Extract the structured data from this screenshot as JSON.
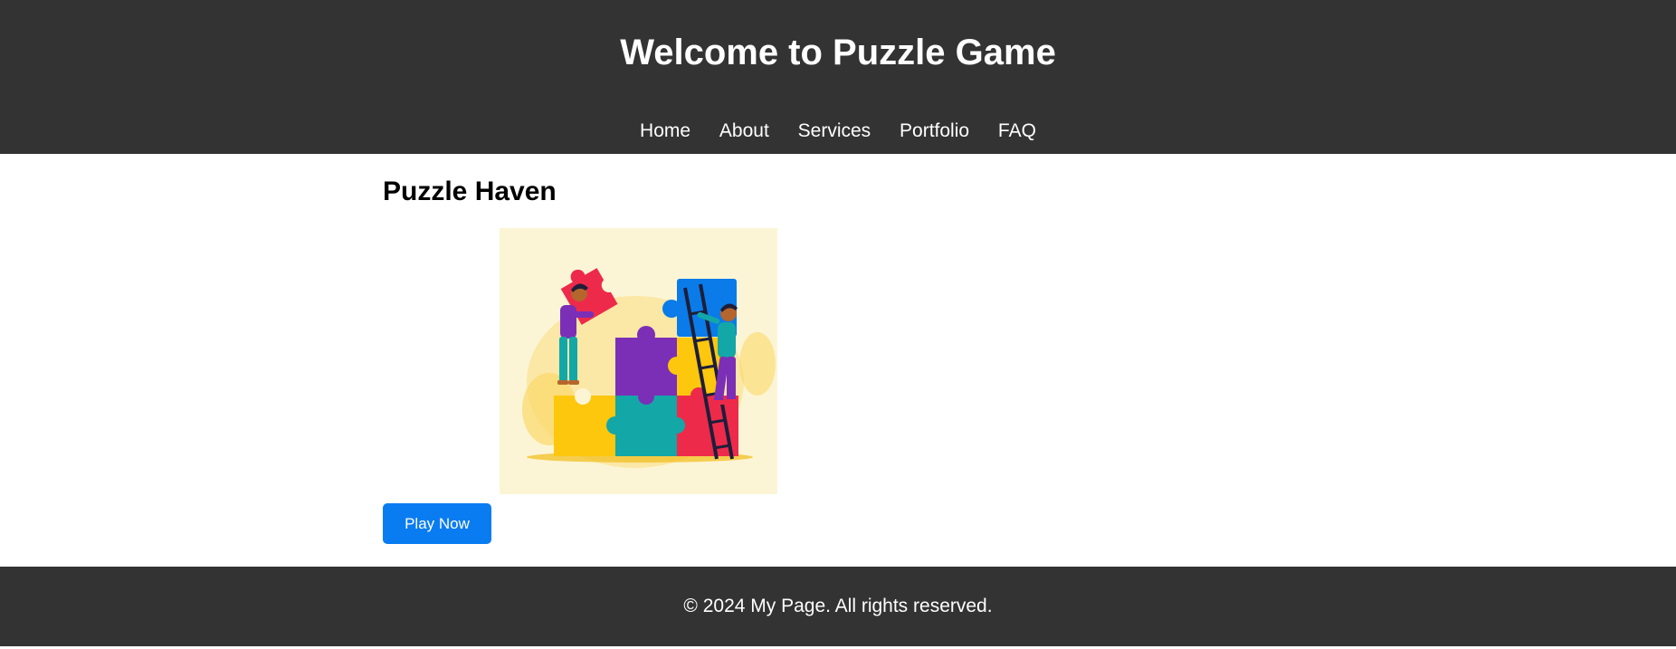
{
  "header": {
    "title": "Welcome to Puzzle Game"
  },
  "nav": {
    "items": [
      {
        "label": "Home"
      },
      {
        "label": "About"
      },
      {
        "label": "Services"
      },
      {
        "label": "Portfolio"
      },
      {
        "label": "FAQ"
      }
    ]
  },
  "main": {
    "heading": "Puzzle Haven",
    "image_icon": "puzzle-team-illustration",
    "play_button": "Play Now"
  },
  "footer": {
    "text": "© 2024 My Page. All rights reserved."
  },
  "colors": {
    "header_bg": "#333333",
    "footer_bg": "#333333",
    "button_bg": "#0a7cf2",
    "image_bg": "#fcf5d5"
  }
}
